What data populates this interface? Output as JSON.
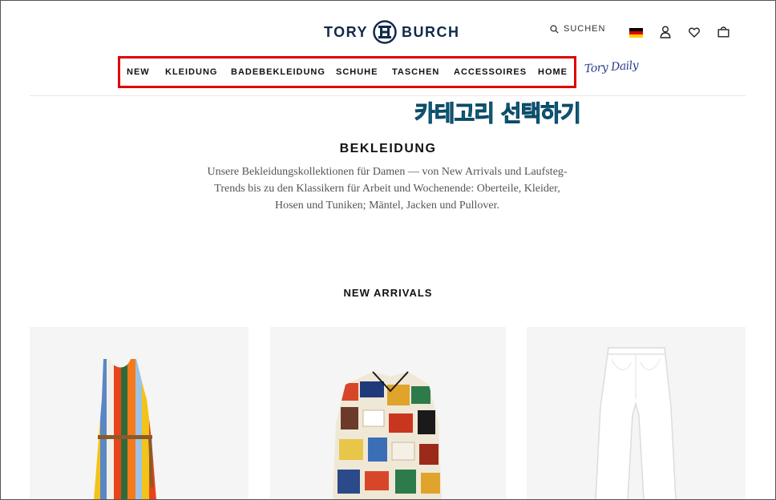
{
  "brand": {
    "logo_text_left": "TORY",
    "logo_text_right": "BURCH"
  },
  "header": {
    "search_label": "SUCHEN",
    "flag_colors": [
      "#000000",
      "#dd0000",
      "#ffce00"
    ]
  },
  "nav": {
    "items": [
      {
        "label": "NEW"
      },
      {
        "label": "KLEIDUNG"
      },
      {
        "label": "BADEBEKLEIDUNG"
      },
      {
        "label": "SCHUHE"
      },
      {
        "label": "TASCHEN"
      },
      {
        "label": "ACCESSOIRES"
      },
      {
        "label": "HOME"
      }
    ],
    "signature_text": "Tory Daily",
    "highlight_color": "#e00000"
  },
  "annotation": {
    "text": "카테고리 선택하기",
    "color": "#1eaad6"
  },
  "category": {
    "title": "BEKLEIDUNG",
    "description": "Unsere Bekleidungskollektionen für Damen — von New Arrivals und Laufsteg-Trends bis zu den Klassikern für Arbeit und Wochenende: Oberteile, Kleider, Hosen und Tuniken; Mäntel, Jacken und Pullover."
  },
  "new_arrivals": {
    "title": "NEW ARRIVALS",
    "products": [
      {
        "image": "striped-sleeveless-dress"
      },
      {
        "image": "patchwork-print-shirt"
      },
      {
        "image": "white-cropped-jeans"
      }
    ]
  }
}
